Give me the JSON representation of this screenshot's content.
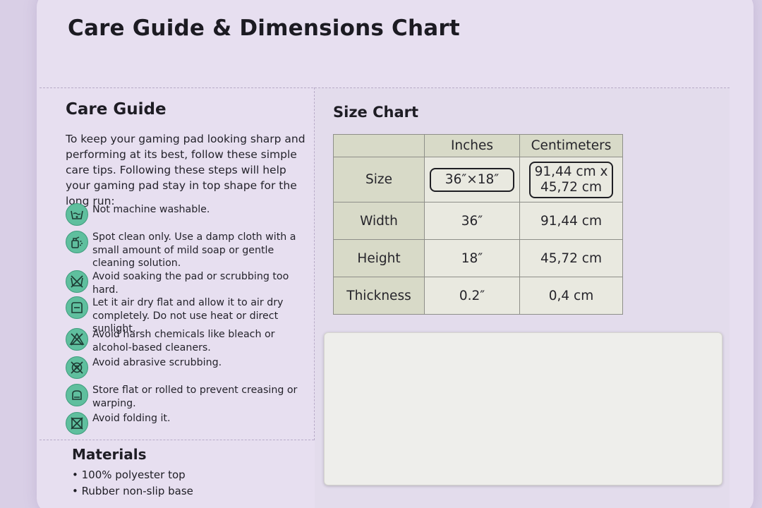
{
  "page_title": "Care Guide & Dimensions Chart",
  "care_guide": {
    "title": "Care Guide",
    "intro": "To keep your gaming pad looking sharp and performing at its best, follow these simple care tips. Following these steps will help your gaming pad stay in top shape for the long run:",
    "items": [
      {
        "icon": "no-machine-wash-icon",
        "text": "Not machine washable."
      },
      {
        "icon": "spot-clean-icon",
        "text": "Spot clean only. Use a damp cloth with a small amount of mild soap or gentle cleaning solution."
      },
      {
        "icon": "no-soak-icon",
        "text": "Avoid soaking the pad or scrubbing too hard."
      },
      {
        "icon": "air-dry-icon",
        "text": "Let it air dry flat and allow it to air dry completely. Do not use heat or direct sunlight."
      },
      {
        "icon": "no-bleach-icon",
        "text": "Avoid harsh chemicals like bleach or alcohol-based cleaners."
      },
      {
        "icon": "no-scrub-icon",
        "text": "Avoid abrasive scrubbing."
      },
      {
        "icon": "store-flat-icon",
        "text": "Store flat or rolled to prevent creasing or warping."
      },
      {
        "icon": "no-fold-icon",
        "text": "Avoid folding it."
      }
    ]
  },
  "materials": {
    "title": "Materials",
    "items": [
      "• 100% polyester top",
      "• Rubber non-slip base"
    ]
  },
  "size_chart": {
    "title": "Size Chart",
    "headers": [
      "",
      "Inches",
      "Centimeters"
    ],
    "rows": [
      {
        "label": "Size",
        "inches": "36″×18″",
        "cm_line1": "91,44 cm x",
        "cm_line2": "45,72 cm"
      },
      {
        "label": "Width",
        "inches": "36″",
        "cm": "91,44 cm"
      },
      {
        "label": "Height",
        "inches": "18″",
        "cm": "45,72 cm"
      },
      {
        "label": "Thickness",
        "inches": "0.2″",
        "cm": "0,4 cm"
      }
    ]
  },
  "colors": {
    "icon_fill": "#5fbf9e",
    "table_header": "#d8dac8",
    "background": "#d9cfe6"
  }
}
